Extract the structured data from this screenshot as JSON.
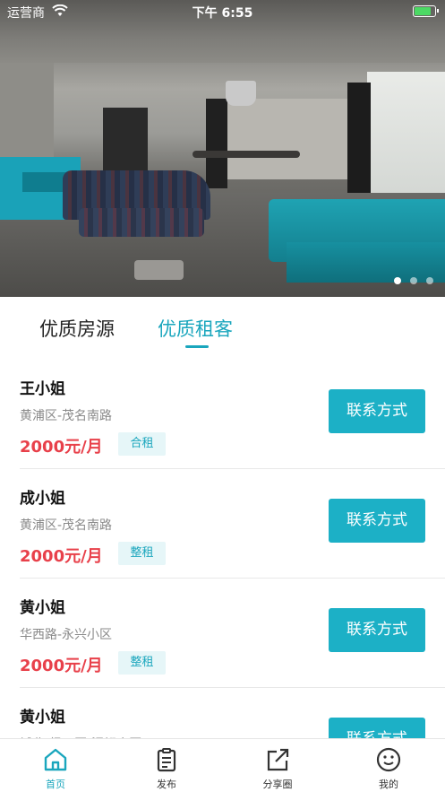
{
  "status_bar": {
    "carrier": "运营商",
    "time": "下午 6:55"
  },
  "banner": {
    "page_count": 3,
    "active_page": 1
  },
  "tabs": [
    {
      "label": "优质房源",
      "active": false
    },
    {
      "label": "优质租客",
      "active": true
    }
  ],
  "listings": [
    {
      "name": "王小姐",
      "address": "黄浦区-茂名南路",
      "price": "2000元/月",
      "type": "合租",
      "button": "联系方式"
    },
    {
      "name": "成小姐",
      "address": "黄浦区-茂名南路",
      "price": "2000元/月",
      "type": "整租",
      "button": "联系方式"
    },
    {
      "name": "黄小姐",
      "address": "华西路-永兴小区",
      "price": "2000元/月",
      "type": "整租",
      "button": "联系方式"
    },
    {
      "name": "黄小姐",
      "address": "城北-经开区-泥翘小区",
      "price": "",
      "type": "",
      "button": "联系方式"
    }
  ],
  "tabbar": [
    {
      "label": "首页",
      "icon": "home-icon",
      "active": true
    },
    {
      "label": "发布",
      "icon": "clipboard-icon",
      "active": false
    },
    {
      "label": "分享圈",
      "icon": "share-icon",
      "active": false
    },
    {
      "label": "我的",
      "icon": "smiley-icon",
      "active": false
    }
  ],
  "colors": {
    "accent": "#1aa6bd",
    "button": "#1cb0c6",
    "price": "#e8404a",
    "tag_bg": "#e6f6f8"
  }
}
